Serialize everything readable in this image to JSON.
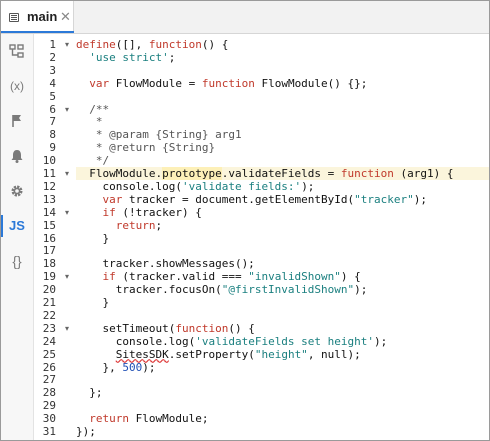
{
  "tab": {
    "label": "main",
    "close": "✕"
  },
  "sidebar": {
    "items": [
      {
        "name": "structure-icon"
      },
      {
        "name": "variables-icon",
        "label": "(x)"
      },
      {
        "name": "flag-icon"
      },
      {
        "name": "bell-icon"
      },
      {
        "name": "gear-icon"
      },
      {
        "name": "js-icon",
        "label": "JS"
      },
      {
        "name": "braces-icon",
        "label": "{}"
      }
    ]
  },
  "editor": {
    "highlighted_line": 11,
    "lines": [
      {
        "n": "1",
        "text": "define([], function() {"
      },
      {
        "n": "2",
        "text": "  'use strict';"
      },
      {
        "n": "3",
        "text": ""
      },
      {
        "n": "4",
        "text": "  var FlowModule = function FlowModule() {};"
      },
      {
        "n": "5",
        "text": ""
      },
      {
        "n": "6",
        "text": "  /**"
      },
      {
        "n": "7",
        "text": "   *"
      },
      {
        "n": "8",
        "text": "   * @param {String} arg1"
      },
      {
        "n": "9",
        "text": "   * @return {String}"
      },
      {
        "n": "10",
        "text": "   */"
      },
      {
        "n": "11",
        "text": "  FlowModule.prototype.validateFields = function (arg1) {"
      },
      {
        "n": "12",
        "text": "    console.log('validate fields:');"
      },
      {
        "n": "13",
        "text": "    var tracker = document.getElementById(\"tracker\");"
      },
      {
        "n": "14",
        "text": "    if (!tracker) {"
      },
      {
        "n": "15",
        "text": "      return;"
      },
      {
        "n": "16",
        "text": "    }"
      },
      {
        "n": "17",
        "text": ""
      },
      {
        "n": "18",
        "text": "    tracker.showMessages();"
      },
      {
        "n": "19",
        "text": "    if (tracker.valid === \"invalidShown\") {"
      },
      {
        "n": "20",
        "text": "      tracker.focusOn(\"@firstInvalidShown\");"
      },
      {
        "n": "21",
        "text": "    }"
      },
      {
        "n": "22",
        "text": ""
      },
      {
        "n": "23",
        "text": "    setTimeout(function() {"
      },
      {
        "n": "24",
        "text": "      console.log('validateFields set height');"
      },
      {
        "n": "25",
        "text": "      SitesSDK.setProperty(\"height\", null);"
      },
      {
        "n": "26",
        "text": "    }, 500);"
      },
      {
        "n": "27",
        "text": ""
      },
      {
        "n": "28",
        "text": "  };"
      },
      {
        "n": "29",
        "text": ""
      },
      {
        "n": "30",
        "text": "  return FlowModule;"
      },
      {
        "n": "31",
        "text": "});"
      }
    ]
  }
}
